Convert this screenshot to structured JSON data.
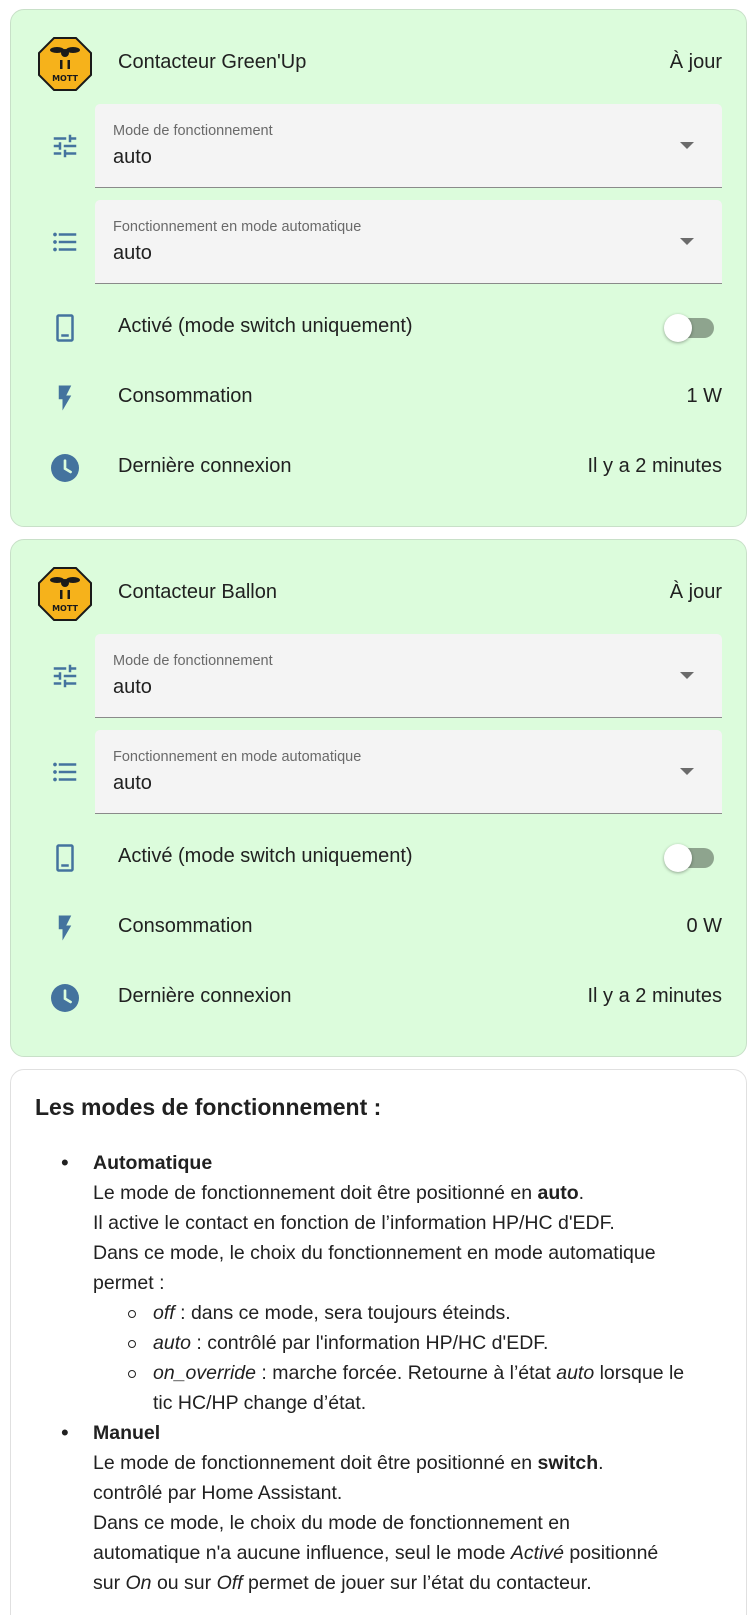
{
  "devices": [
    {
      "name": "Contacteur Green'Up",
      "status": "À jour",
      "mode_select": {
        "label": "Mode de fonctionnement",
        "value": "auto"
      },
      "auto_select": {
        "label": "Fonctionnement en mode automatique",
        "value": "auto"
      },
      "switch": {
        "label": "Activé (mode switch uniquement)",
        "state": "off"
      },
      "power": {
        "label": "Consommation",
        "value": "1 W"
      },
      "last_seen": {
        "label": "Dernière connexion",
        "value": "Il y a 2 minutes"
      }
    },
    {
      "name": "Contacteur Ballon",
      "status": "À jour",
      "mode_select": {
        "label": "Mode de fonctionnement",
        "value": "auto"
      },
      "auto_select": {
        "label": "Fonctionnement en mode automatique",
        "value": "auto"
      },
      "switch": {
        "label": "Activé (mode switch uniquement)",
        "state": "off"
      },
      "power": {
        "label": "Consommation",
        "value": "0 W"
      },
      "last_seen": {
        "label": "Dernière connexion",
        "value": "Il y a 2 minutes"
      }
    }
  ],
  "icons": {
    "device": "mott-logo",
    "mode": "tune-sliders-icon",
    "auto": "format-list-bulleted-icon",
    "switch": "cellphone-icon",
    "power": "flash-icon",
    "last_seen": "clock-icon"
  },
  "logo_text": "MOTT",
  "colors": {
    "card_background": "#dcfcdc",
    "icon_blue": "#44739e",
    "logo_yellow": "#f6b21b"
  },
  "info": {
    "title": "Les modes de fonctionnement :",
    "auto": {
      "heading": "Automatique",
      "l1_pre": "Le mode de fonctionnement doit être positionné en ",
      "l1_bold": "auto",
      "l1_post": ".",
      "l2": "Il active le contact en fonction de l’information HP/HC d'EDF.",
      "l3": "Dans ce mode, le choix du fonctionnement en mode automatique",
      "l4": "permet :",
      "opt_off_name": "off",
      "opt_off_desc": " : dans ce mode, sera toujours éteinds.",
      "opt_auto_name": "auto",
      "opt_auto_desc": " : contrôlé par l'information HP/HC d'EDF.",
      "opt_override_name": "on_override",
      "opt_override_desc1": " : marche forcée. Retourne à l’état ",
      "opt_override_desc_em": "auto",
      "opt_override_desc2": " lorsque le",
      "opt_override_desc3": "tic HC/HP change d’état."
    },
    "manual": {
      "heading": "Manuel",
      "l1_pre": "Le mode de fonctionnement doit être positionné en ",
      "l1_bold": "switch",
      "l1_post": ".",
      "l2": "contrôlé par Home Assistant.",
      "l3": "Dans ce mode, le choix du mode de fonctionnement en",
      "l4_pre": "automatique n'a aucune influence, seul le mode ",
      "l4_em": "Activé",
      "l4_post": " positionné",
      "l5_pre": "sur ",
      "l5_em1": "On",
      "l5_mid": " ou sur ",
      "l5_em2": "Off",
      "l5_post": " permet de jouer sur l’état du contacteur."
    }
  }
}
